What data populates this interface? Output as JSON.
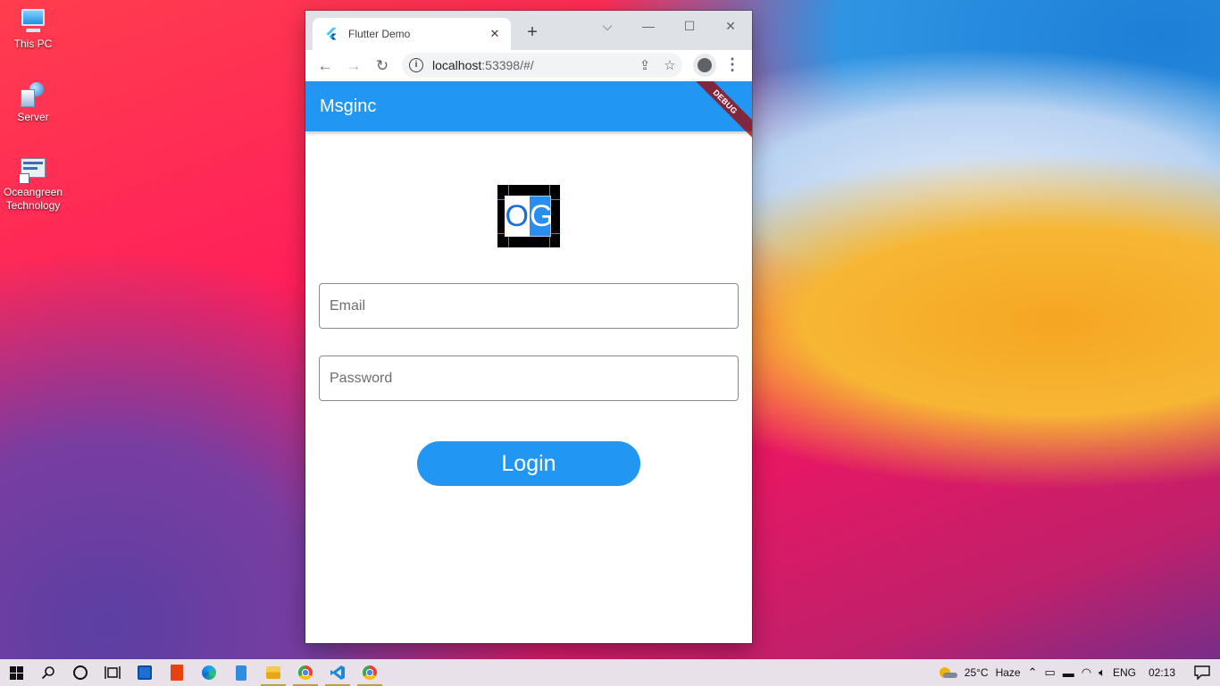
{
  "desktop": {
    "icons": [
      {
        "label": "This PC",
        "icon": "this-pc-icon"
      },
      {
        "label": "Server",
        "icon": "server-shortcut-icon"
      },
      {
        "label": "Oceangreen Technology",
        "icon": "oceangreen-shortcut-icon"
      }
    ]
  },
  "browser": {
    "tab": {
      "title": "Flutter Demo",
      "close": "✕"
    },
    "new_tab": "+",
    "window_controls": {
      "dropdown": "⌵",
      "minimize": "—",
      "maximize": "☐",
      "close": "✕"
    },
    "toolbar": {
      "back": "←",
      "forward": "→",
      "reload": "↻",
      "menu": "⋮"
    },
    "address": {
      "host": "localhost",
      "rest": ":53398/#/",
      "share": "⇪",
      "bookmark": "☆"
    }
  },
  "app": {
    "appbar_title": "Msginc",
    "debug_banner": "DEBUG",
    "logo_text": {
      "o": "O",
      "g": "G"
    },
    "email_placeholder": "Email",
    "password_placeholder": "Password",
    "login_label": "Login"
  },
  "taskbar": {
    "pinned": [
      "windows-start",
      "search",
      "cortana",
      "task-view",
      "store",
      "office",
      "edge",
      "notepad",
      "file-explorer",
      "chrome",
      "vscode",
      "chrome-2"
    ],
    "tray": {
      "temperature": "25°C",
      "weather": "Haze",
      "language": "ENG",
      "time": "02:13"
    },
    "colors": {
      "accent": "#2196f3",
      "taskbar_bg": "#e8e1ea"
    }
  }
}
